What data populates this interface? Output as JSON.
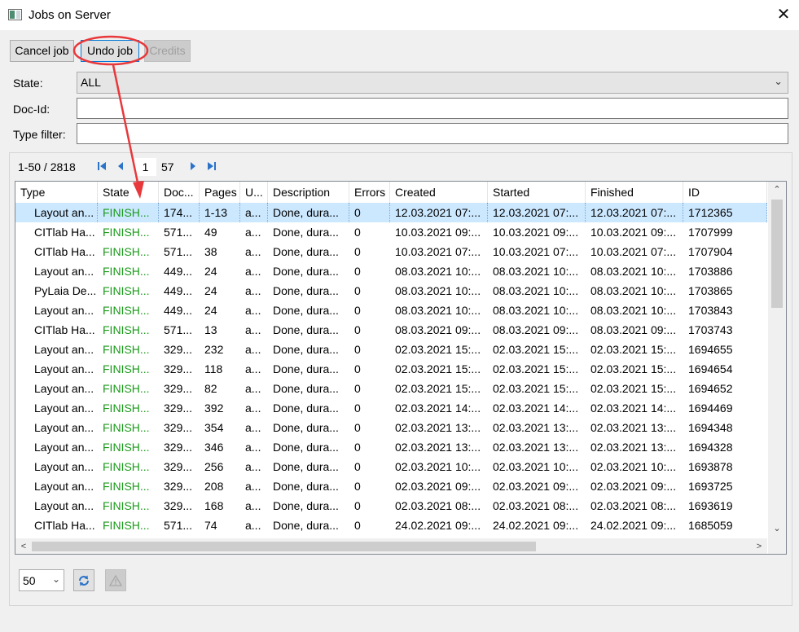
{
  "window": {
    "title": "Jobs on Server",
    "close_glyph": "✕",
    "icon": "app-window-icon"
  },
  "toolbar": {
    "cancel_label": "Cancel job",
    "undo_label": "Undo job",
    "credits_label": "Credits"
  },
  "filters": {
    "state_label": "State:",
    "state_value": "ALL",
    "docid_label": "Doc-Id:",
    "docid_value": "",
    "type_label": "Type filter:",
    "type_value": ""
  },
  "pager": {
    "range": "1-50 / 2818",
    "page": "1",
    "total_pages": "57"
  },
  "table": {
    "columns": [
      "Type",
      "State",
      "Doc...",
      "Pages",
      "U...",
      "Description",
      "Errors",
      "Created",
      "Started",
      "Finished",
      "ID"
    ],
    "rows": [
      [
        "Layout an...",
        "FINISH...",
        "174...",
        "1-13",
        "a...",
        "Done, dura...",
        "0",
        "12.03.2021 07:...",
        "12.03.2021 07:...",
        "12.03.2021 07:...",
        "1712365"
      ],
      [
        "CITlab Ha...",
        "FINISH...",
        "571...",
        "49",
        "a...",
        "Done, dura...",
        "0",
        "10.03.2021 09:...",
        "10.03.2021 09:...",
        "10.03.2021 09:...",
        "1707999"
      ],
      [
        "CITlab Ha...",
        "FINISH...",
        "571...",
        "38",
        "a...",
        "Done, dura...",
        "0",
        "10.03.2021 07:...",
        "10.03.2021 07:...",
        "10.03.2021 07:...",
        "1707904"
      ],
      [
        "Layout an...",
        "FINISH...",
        "449...",
        "24",
        "a...",
        "Done, dura...",
        "0",
        "08.03.2021 10:...",
        "08.03.2021 10:...",
        "08.03.2021 10:...",
        "1703886"
      ],
      [
        "PyLaia De...",
        "FINISH...",
        "449...",
        "24",
        "a...",
        "Done, dura...",
        "0",
        "08.03.2021 10:...",
        "08.03.2021 10:...",
        "08.03.2021 10:...",
        "1703865"
      ],
      [
        "Layout an...",
        "FINISH...",
        "449...",
        "24",
        "a...",
        "Done, dura...",
        "0",
        "08.03.2021 10:...",
        "08.03.2021 10:...",
        "08.03.2021 10:...",
        "1703843"
      ],
      [
        "CITlab Ha...",
        "FINISH...",
        "571...",
        "13",
        "a...",
        "Done, dura...",
        "0",
        "08.03.2021 09:...",
        "08.03.2021 09:...",
        "08.03.2021 09:...",
        "1703743"
      ],
      [
        "Layout an...",
        "FINISH...",
        "329...",
        "232",
        "a...",
        "Done, dura...",
        "0",
        "02.03.2021 15:...",
        "02.03.2021 15:...",
        "02.03.2021 15:...",
        "1694655"
      ],
      [
        "Layout an...",
        "FINISH...",
        "329...",
        "118",
        "a...",
        "Done, dura...",
        "0",
        "02.03.2021 15:...",
        "02.03.2021 15:...",
        "02.03.2021 15:...",
        "1694654"
      ],
      [
        "Layout an...",
        "FINISH...",
        "329...",
        "82",
        "a...",
        "Done, dura...",
        "0",
        "02.03.2021 15:...",
        "02.03.2021 15:...",
        "02.03.2021 15:...",
        "1694652"
      ],
      [
        "Layout an...",
        "FINISH...",
        "329...",
        "392",
        "a...",
        "Done, dura...",
        "0",
        "02.03.2021 14:...",
        "02.03.2021 14:...",
        "02.03.2021 14:...",
        "1694469"
      ],
      [
        "Layout an...",
        "FINISH...",
        "329...",
        "354",
        "a...",
        "Done, dura...",
        "0",
        "02.03.2021 13:...",
        "02.03.2021 13:...",
        "02.03.2021 13:...",
        "1694348"
      ],
      [
        "Layout an...",
        "FINISH...",
        "329...",
        "346",
        "a...",
        "Done, dura...",
        "0",
        "02.03.2021 13:...",
        "02.03.2021 13:...",
        "02.03.2021 13:...",
        "1694328"
      ],
      [
        "Layout an...",
        "FINISH...",
        "329...",
        "256",
        "a...",
        "Done, dura...",
        "0",
        "02.03.2021 10:...",
        "02.03.2021 10:...",
        "02.03.2021 10:...",
        "1693878"
      ],
      [
        "Layout an...",
        "FINISH...",
        "329...",
        "208",
        "a...",
        "Done, dura...",
        "0",
        "02.03.2021 09:...",
        "02.03.2021 09:...",
        "02.03.2021 09:...",
        "1693725"
      ],
      [
        "Layout an...",
        "FINISH...",
        "329...",
        "168",
        "a...",
        "Done, dura...",
        "0",
        "02.03.2021 08:...",
        "02.03.2021 08:...",
        "02.03.2021 08:...",
        "1693619"
      ],
      [
        "CITlab Ha...",
        "FINISH...",
        "571...",
        "74",
        "a...",
        "Done, dura...",
        "0",
        "24.02.2021 09:...",
        "24.02.2021 09:...",
        "24.02.2021 09:...",
        "1685059"
      ]
    ],
    "selected_row": 0
  },
  "bottom": {
    "page_size": "50",
    "refresh_icon": "refresh-icon",
    "warning_icon": "warning-icon"
  },
  "colors": {
    "finished_state": "#1a9a1a",
    "selected_row": "#cce8ff",
    "annotation": "#e8383b",
    "nav_icon": "#2b73c9"
  }
}
